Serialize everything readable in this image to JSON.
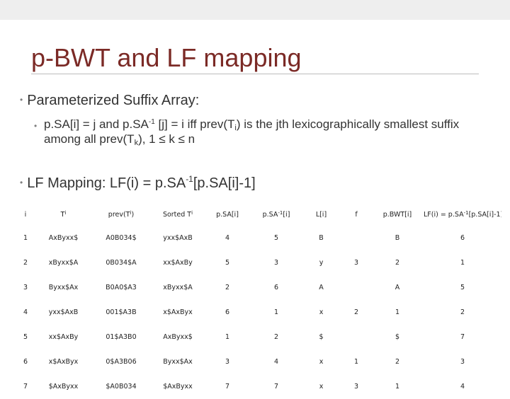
{
  "slide": {
    "title": "p-BWT and LF mapping",
    "bullet1": "Parameterized Suffix Array:",
    "bullet2_part1": "p.SA[i] = j and p.SA",
    "bullet2_sup1": "-1",
    "bullet2_part2": " [j] = i iff prev(T",
    "bullet2_sub1": "i",
    "bullet2_part3": ") is the jth lexicographically smallest suffix among all prev(T",
    "bullet2_sub2": "k",
    "bullet2_part4": "), 1 ≤ k ≤ n",
    "bullet3_part1": "LF Mapping:  LF(i) = p.SA",
    "bullet3_sup": "-1",
    "bullet3_part2": "[p.SA[i]-1]"
  },
  "table": {
    "headers": {
      "i": "i",
      "t_base": "T",
      "t_sub": "i",
      "prev_base": "prev(T",
      "prev_sub": "i",
      "prev_end": ")",
      "sorted_base": "Sorted T",
      "sorted_sub": "i",
      "psa": "p.SA[i]",
      "psainv_base": "p.SA",
      "psainv_sup": "-1",
      "psainv_end": "[i]",
      "L": "L[i]",
      "f": "f",
      "pbwt": "p.BWT[i]",
      "lf_base": "LF(i) = p.SA",
      "lf_sup": "-1",
      "lf_end": "[p.SA[i]-1]"
    },
    "rows": [
      {
        "i": "1",
        "t": "AxByxx$",
        "prev": "A0B034$",
        "sorted": "yxx$AxB",
        "psa": "4",
        "psainv": "5",
        "L": "B",
        "f": "",
        "pbwt": "B",
        "lf": "6"
      },
      {
        "i": "2",
        "t": "xByxx$A",
        "prev": "0B034$A",
        "sorted": "xx$AxBy",
        "psa": "5",
        "psainv": "3",
        "L": "y",
        "f": "3",
        "pbwt": "2",
        "lf": "1"
      },
      {
        "i": "3",
        "t": "Byxx$Ax",
        "prev": "B0A0$A3",
        "sorted": "xByxx$A",
        "psa": "2",
        "psainv": "6",
        "L": "A",
        "f": "",
        "pbwt": "A",
        "lf": "5"
      },
      {
        "i": "4",
        "t": "yxx$AxB",
        "prev": "001$A3B",
        "sorted": "x$AxByx",
        "psa": "6",
        "psainv": "1",
        "L": "x",
        "f": "2",
        "pbwt": "1",
        "lf": "2"
      },
      {
        "i": "5",
        "t": "xx$AxBy",
        "prev": "01$A3B0",
        "sorted": "AxByxx$",
        "psa": "1",
        "psainv": "2",
        "L": "$",
        "f": "",
        "pbwt": "$",
        "lf": "7"
      },
      {
        "i": "6",
        "t": "x$AxByx",
        "prev": "0$A3B06",
        "sorted": "Byxx$Ax",
        "psa": "3",
        "psainv": "4",
        "L": "x",
        "f": "1",
        "pbwt": "2",
        "lf": "3"
      },
      {
        "i": "7",
        "t": "$AxByxx",
        "prev": "$A0B034",
        "sorted": "$AxByxx",
        "psa": "7",
        "psainv": "7",
        "L": "x",
        "f": "3",
        "pbwt": "1",
        "lf": "4"
      }
    ]
  }
}
